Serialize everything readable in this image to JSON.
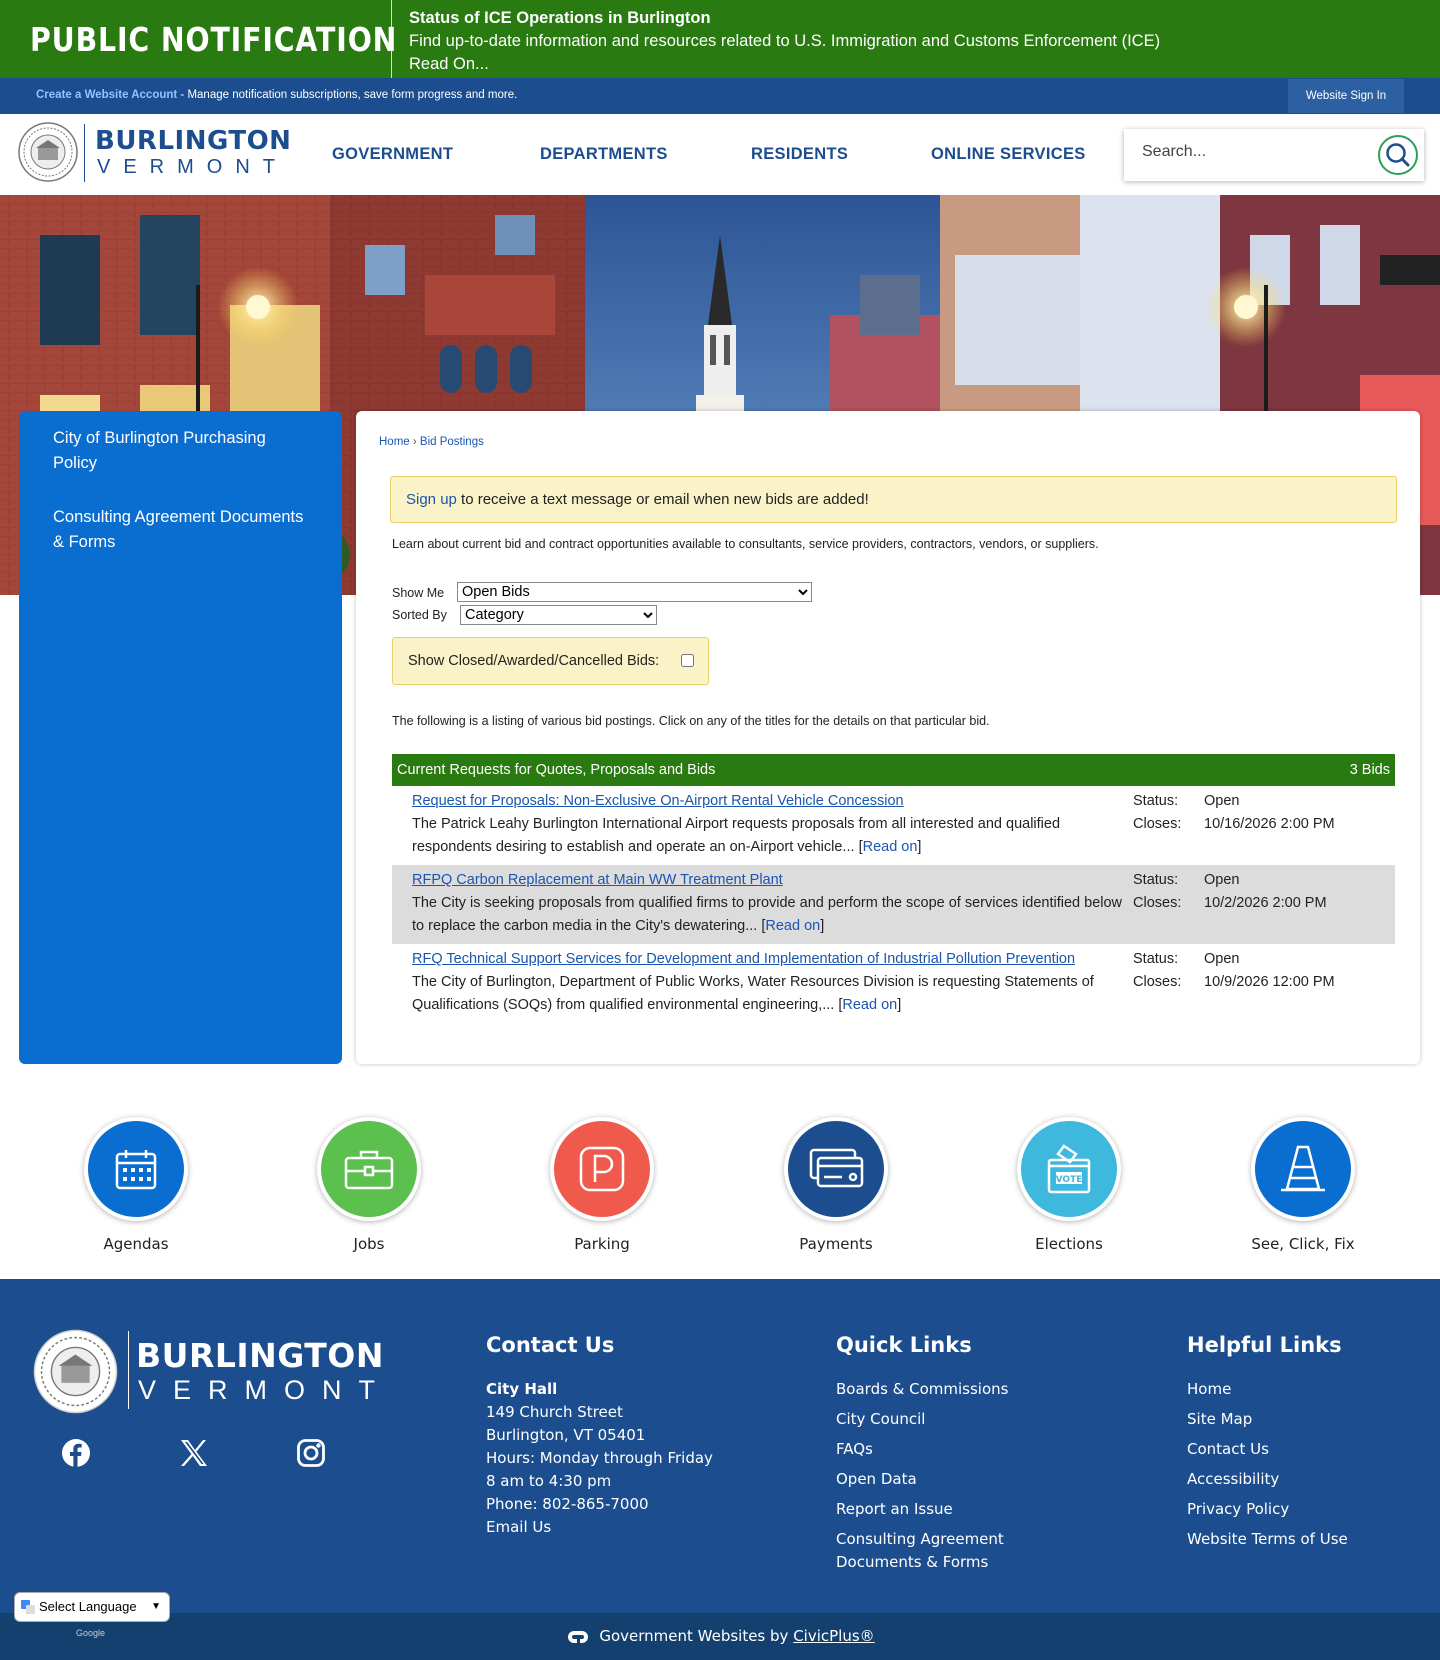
{
  "alert": {
    "logo_text": "PUBLIC NOTIFICATION",
    "title": "Status of ICE Operations in Burlington",
    "body": "Find up-to-date information and resources related to U.S. Immigration and Customs Enforcement (ICE)",
    "read_on": "Read On..."
  },
  "topbar": {
    "create_account": "Create a Website Account",
    "create_account_desc": " - Manage notification subscriptions, save form progress and more.",
    "sign_in": "Website Sign In"
  },
  "header": {
    "logo_line1": "BURLINGTON",
    "logo_line2": "VERMONT",
    "nav": [
      "GOVERNMENT",
      "DEPARTMENTS",
      "RESIDENTS",
      "ONLINE SERVICES"
    ],
    "search_placeholder": "Search..."
  },
  "sidebar": {
    "items": [
      "City of Burlington Purchasing Policy",
      "Consulting Agreement Documents & Forms"
    ]
  },
  "breadcrumb": {
    "home": "Home",
    "sep": " › ",
    "current": "Bid Postings"
  },
  "notice": {
    "link": "Sign up",
    "text": " to receive a text message or email when new bids are added!"
  },
  "intro": "Learn about current bid and contract opportunities available to consultants, service providers, contractors, vendors, or suppliers.",
  "filters": {
    "show_me_label": "Show Me",
    "show_me_value": "Open Bids",
    "sorted_by_label": "Sorted By",
    "sorted_by_value": "Category",
    "closed_label": "Show Closed/Awarded/Cancelled Bids:"
  },
  "listing_text": "The following is a listing of various bid postings. Click on any of the titles for the details on that particular bid.",
  "bids_section": {
    "title": "Current Requests for Quotes, Proposals and Bids",
    "count": "3 Bids",
    "status_label": "Status:",
    "closes_label": "Closes:",
    "read_on": "Read on",
    "items": [
      {
        "title": "Request for Proposals: Non-Exclusive On-Airport Rental Vehicle Concession",
        "desc": "The Patrick Leahy Burlington International Airport requests proposals from all interested and qualified respondents desiring to establish and operate an on-Airport vehicle... ",
        "status": "Open",
        "closes": "10/16/2026 2:00 PM"
      },
      {
        "title": "RFPQ Carbon Replacement at Main WW Treatment Plant",
        "desc": "The City is seeking proposals from qualified firms to provide and perform the scope of services identified below to replace the carbon media in the City's dewatering... ",
        "status": "Open",
        "closes": "10/2/2026 2:00 PM"
      },
      {
        "title": "RFQ Technical Support Services for Development and Implementation of Industrial Pollution Prevention",
        "desc": "The City of Burlington, Department of Public Works, Water Resources Division is requesting Statements of Qualifications (SOQs) from qualified environmental engineering,... ",
        "status": "Open",
        "closes": "10/9/2026 12:00 PM"
      }
    ]
  },
  "quick_links": [
    {
      "label": "Agendas",
      "icon": "calendar-icon",
      "color": "#0a6ed1"
    },
    {
      "label": "Jobs",
      "icon": "briefcase-icon",
      "color": "#5bc04d"
    },
    {
      "label": "Parking",
      "icon": "parking-icon",
      "color": "#ef5a4c"
    },
    {
      "label": "Payments",
      "icon": "credit-card-icon",
      "color": "#1c4d8f"
    },
    {
      "label": "Elections",
      "icon": "ballot-box-icon",
      "color": "#3fb8dd"
    },
    {
      "label": "See, Click, Fix",
      "icon": "traffic-cone-icon",
      "color": "#0a6ed1"
    }
  ],
  "footer": {
    "logo_line1": "BURLINGTON",
    "logo_line2": "VERMONT",
    "contact": {
      "heading": "Contact Us",
      "name": "City Hall",
      "lines": [
        "149 Church Street",
        "Burlington, VT 05401",
        "Hours: Monday through Friday",
        "8 am to 4:30 pm",
        "Phone: 802-865-7000"
      ],
      "email": "Email Us"
    },
    "quick_links": {
      "heading": "Quick Links",
      "items": [
        "Boards & Commissions",
        "City Council",
        "FAQs",
        "Open Data",
        "Report an Issue",
        "Consulting Agreement Documents & Forms"
      ]
    },
    "helpful_links": {
      "heading": "Helpful Links",
      "items": [
        "Home",
        "Site Map",
        "Contact Us",
        "Accessibility",
        "Privacy Policy",
        "Website Terms of Use"
      ]
    }
  },
  "bottom": {
    "prefix": "Government Websites by ",
    "link": "CivicPlus®",
    "language": "Select Language",
    "powered": "Google"
  },
  "colors": {
    "green": "#2a7a12",
    "navy": "#1c4d8f",
    "blue": "#0a6ed1",
    "link": "#1a55b0",
    "notice": "#fbf3c8"
  }
}
